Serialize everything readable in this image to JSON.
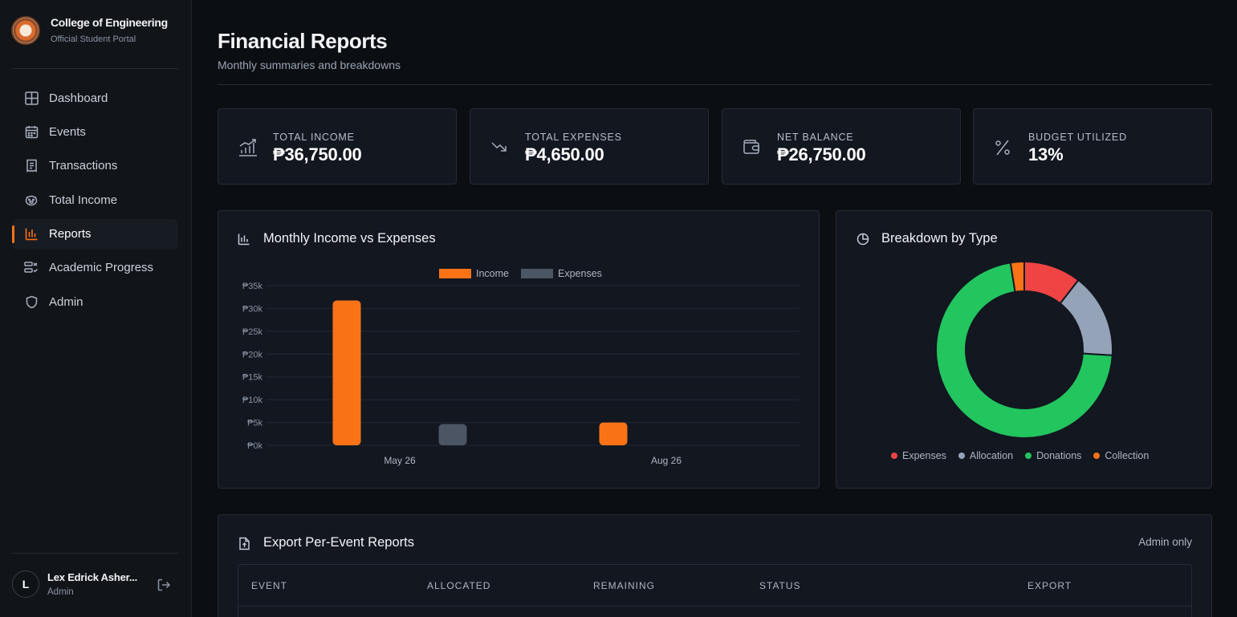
{
  "brand": {
    "title": "College of Engineering",
    "subtitle": "Official Student Portal"
  },
  "nav": [
    {
      "label": "Dashboard",
      "icon": "grid-icon",
      "active": false
    },
    {
      "label": "Events",
      "icon": "calendar-icon",
      "active": false
    },
    {
      "label": "Transactions",
      "icon": "receipt-icon",
      "active": false
    },
    {
      "label": "Total Income",
      "icon": "piggy-bank-icon",
      "active": false
    },
    {
      "label": "Reports",
      "icon": "bar-chart-icon",
      "active": true
    },
    {
      "label": "Academic Progress",
      "icon": "progress-list-icon",
      "active": false
    },
    {
      "label": "Admin",
      "icon": "shield-icon",
      "active": false
    }
  ],
  "user": {
    "initial": "L",
    "name": "Lex Edrick Asher...",
    "role": "Admin"
  },
  "page": {
    "title": "Financial Reports",
    "subtitle": "Monthly summaries and breakdowns"
  },
  "stats": [
    {
      "label": "TOTAL INCOME",
      "value": "₱36,750.00",
      "icon": "trend-bars-icon"
    },
    {
      "label": "TOTAL EXPENSES",
      "value": "₱4,650.00",
      "icon": "trending-down-icon"
    },
    {
      "label": "NET BALANCE",
      "value": "₱26,750.00",
      "icon": "wallet-icon"
    },
    {
      "label": "BUDGET UTILIZED",
      "value": "13%",
      "icon": "percent-icon"
    }
  ],
  "monthly_panel": {
    "title": "Monthly Income vs Expenses"
  },
  "breakdown_panel": {
    "title": "Breakdown by Type"
  },
  "export_panel": {
    "title": "Export Per-Event Reports",
    "badge": "Admin only",
    "columns": [
      "EVENT",
      "ALLOCATED",
      "REMAINING",
      "STATUS",
      "EXPORT"
    ]
  },
  "colors": {
    "accent": "#f97316",
    "expenses_bar": "#4b5563",
    "pie_expenses": "#ef4444",
    "pie_allocation": "#94a3b8",
    "pie_donations": "#22c55e",
    "pie_collection": "#f97316"
  },
  "chart_data": [
    {
      "type": "bar",
      "categories": [
        "May 26",
        "Aug 26"
      ],
      "series": [
        {
          "name": "Income",
          "values": [
            31750,
            5000
          ]
        },
        {
          "name": "Expenses",
          "values": [
            4650,
            0
          ]
        }
      ],
      "yticks": [
        "₱0k",
        "₱5k",
        "₱10k",
        "₱15k",
        "₱20k",
        "₱25k",
        "₱30k",
        "₱35k"
      ],
      "ylim": [
        0,
        35000
      ],
      "legend": "top-center",
      "grid": true
    },
    {
      "type": "pie",
      "donut": true,
      "labels": [
        "Expenses",
        "Allocation",
        "Donations",
        "Collection"
      ],
      "values": [
        10.5,
        15.5,
        71.5,
        2.5
      ],
      "legend": "bottom"
    }
  ]
}
